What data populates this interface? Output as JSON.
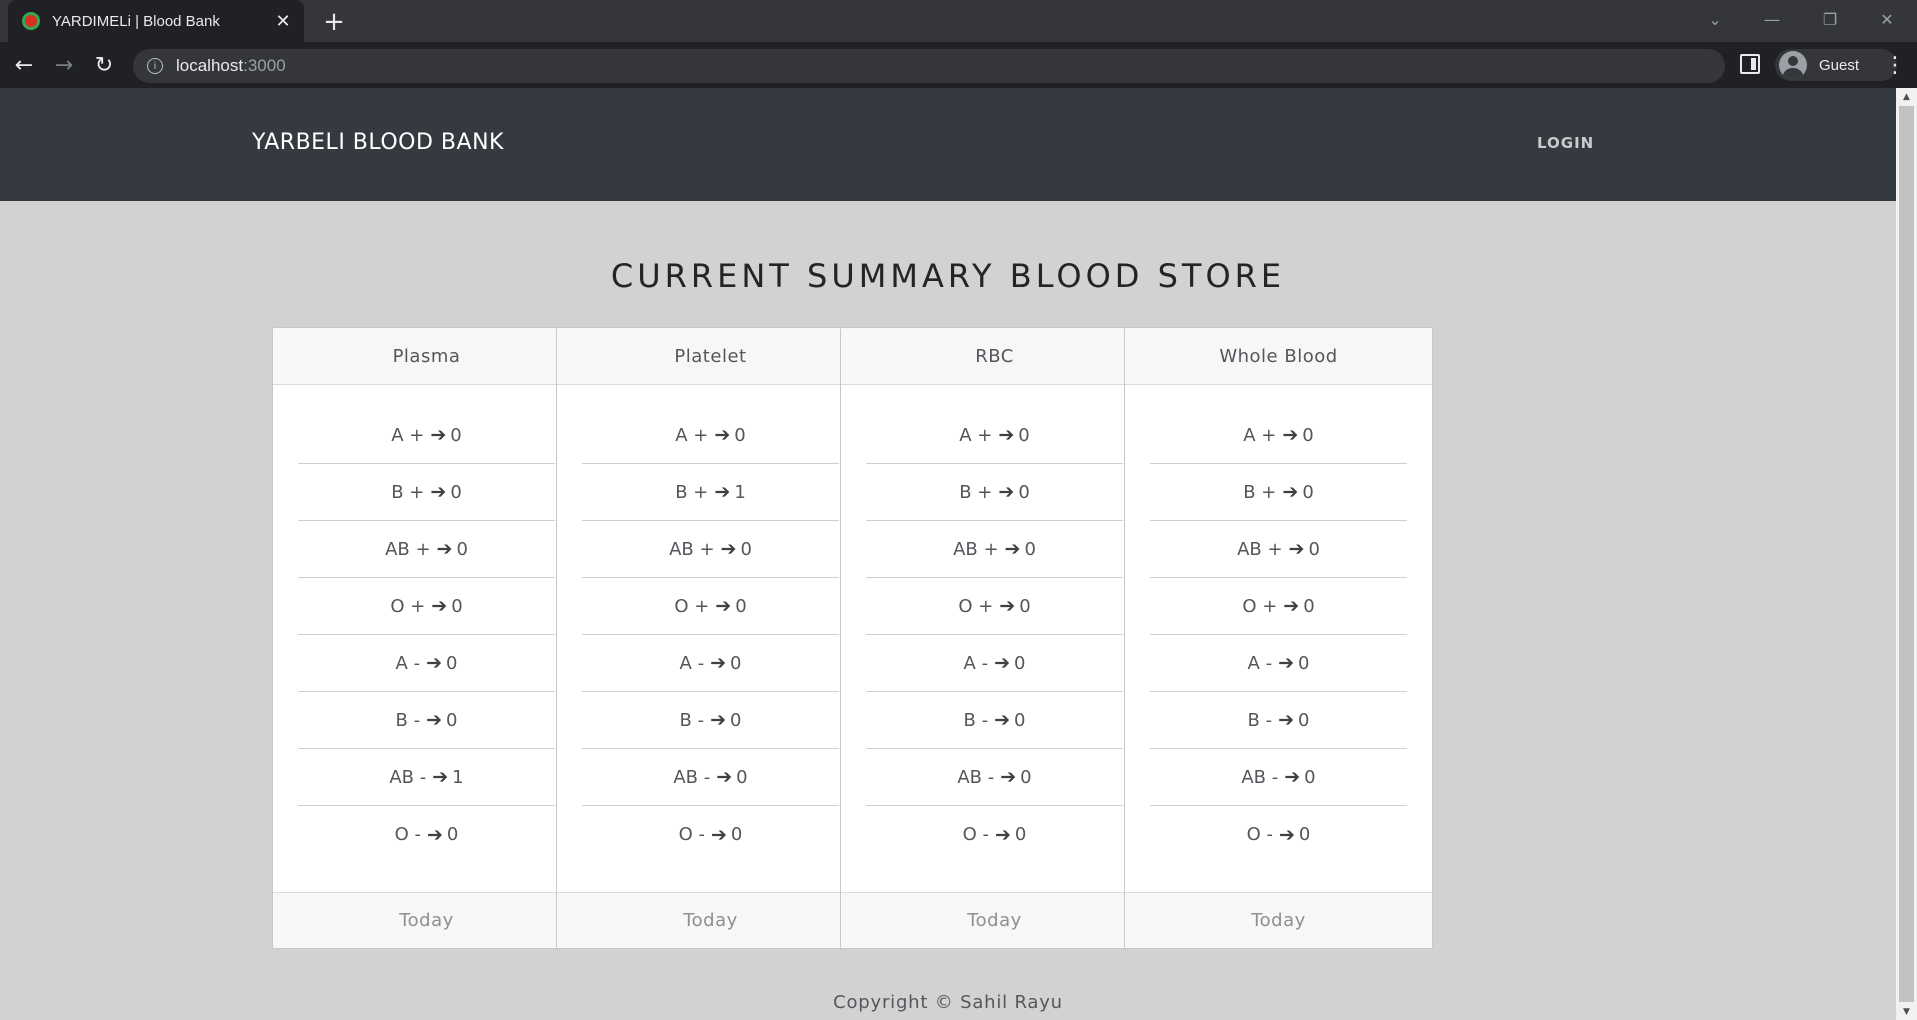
{
  "browser": {
    "tab_title": "YARDIMELi | Blood Bank",
    "url_host": "localhost",
    "url_port": ":3000",
    "profile_label": "Guest"
  },
  "navbar": {
    "brand": "YARBELI BLOOD BANK",
    "login": "LOGIN"
  },
  "heading": "CURRENT SUMMARY BLOOD STORE",
  "arrow_glyph": "➔",
  "cards": [
    {
      "title": "Plasma",
      "rows": [
        {
          "group": "A +",
          "count": "0"
        },
        {
          "group": "B +",
          "count": "0"
        },
        {
          "group": "AB +",
          "count": "0"
        },
        {
          "group": "O +",
          "count": "0"
        },
        {
          "group": "A -",
          "count": "0"
        },
        {
          "group": "B -",
          "count": "0"
        },
        {
          "group": "AB -",
          "count": "1"
        },
        {
          "group": "O -",
          "count": "0"
        }
      ],
      "footer": "Today"
    },
    {
      "title": "Platelet",
      "rows": [
        {
          "group": "A +",
          "count": "0"
        },
        {
          "group": "B +",
          "count": "1"
        },
        {
          "group": "AB +",
          "count": "0"
        },
        {
          "group": "O +",
          "count": "0"
        },
        {
          "group": "A -",
          "count": "0"
        },
        {
          "group": "B -",
          "count": "0"
        },
        {
          "group": "AB -",
          "count": "0"
        },
        {
          "group": "O -",
          "count": "0"
        }
      ],
      "footer": "Today"
    },
    {
      "title": "RBC",
      "rows": [
        {
          "group": "A +",
          "count": "0"
        },
        {
          "group": "B +",
          "count": "0"
        },
        {
          "group": "AB +",
          "count": "0"
        },
        {
          "group": "O +",
          "count": "0"
        },
        {
          "group": "A -",
          "count": "0"
        },
        {
          "group": "B -",
          "count": "0"
        },
        {
          "group": "AB -",
          "count": "0"
        },
        {
          "group": "O -",
          "count": "0"
        }
      ],
      "footer": "Today"
    },
    {
      "title": "Whole Blood",
      "rows": [
        {
          "group": "A +",
          "count": "0"
        },
        {
          "group": "B +",
          "count": "0"
        },
        {
          "group": "AB +",
          "count": "0"
        },
        {
          "group": "O +",
          "count": "0"
        },
        {
          "group": "A -",
          "count": "0"
        },
        {
          "group": "B -",
          "count": "0"
        },
        {
          "group": "AB -",
          "count": "0"
        },
        {
          "group": "O -",
          "count": "0"
        }
      ],
      "footer": "Today"
    }
  ],
  "footer": "Copyright © Sahil Rayu"
}
